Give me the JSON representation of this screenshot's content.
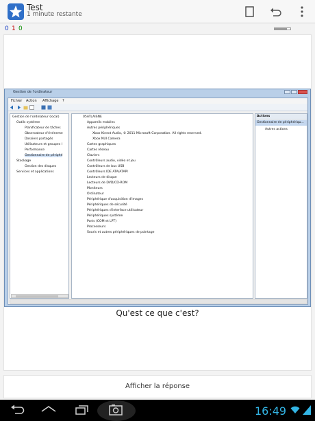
{
  "app": {
    "title": "Test",
    "subtitle": "1 minute restante"
  },
  "stats": {
    "new": "0",
    "learning": "1",
    "review": "0",
    "colors": {
      "new": "#1a3fc4",
      "learning": "#c00000",
      "review": "#0a8a00"
    },
    "progress_fraction": 0.8
  },
  "toolbar_icons": [
    "card-outline-icon",
    "undo-icon",
    "overflow-menu-icon"
  ],
  "card": {
    "question": "Qu'est ce que c'est?",
    "answer_button": "Afficher la réponse"
  },
  "embedded_window": {
    "title": "Gestion de l'ordinateur",
    "menu": [
      "Fichier",
      "Action",
      "Affichage",
      "?"
    ],
    "left_tree": [
      "Gestion de l'ordinateur (local)",
      "Outils système",
      "Planificateur de tâches",
      "Observateur d'événeme",
      "Dossiers partagés",
      "Utilisateurs et groupes l",
      "Performance",
      "Gestionnaire de périphé",
      "Stockage",
      "Gestion des disques",
      "Services et applications"
    ],
    "device_root": "05ATLAISNE",
    "device_tree": [
      "Appareils mobiles",
      "Autres périphériques",
      "Xbox Kinect Audio, © 2011 Microsoft Corporation. All rights reserved.",
      "Xbox NUI Camera",
      "Cartes graphiques",
      "Cartes réseau",
      "Claviers",
      "Contrôleurs audio, vidéo et jeu",
      "Contrôleurs de bus USB",
      "Contrôleurs IDE ATA/ATAPI",
      "Lecteurs de disque",
      "Lecteurs de DVD/CD-ROM",
      "Moniteurs",
      "Ordinateur",
      "Périphérique d'acquisition d'images",
      "Périphériques de sécurité",
      "Périphériques d'interface utilisateur",
      "Périphériques système",
      "Ports (COM et LPT)",
      "Processeurs",
      "Souris et autres périphériques de pointage"
    ],
    "actions_header": "Actions",
    "actions_selected": "Gestionnaire de périphériqu...",
    "actions_item": "Autres actions"
  },
  "status": {
    "time": "16:49"
  },
  "nav_icons": [
    "back-icon",
    "home-icon",
    "recent-apps-icon",
    "screenshot-icon"
  ]
}
